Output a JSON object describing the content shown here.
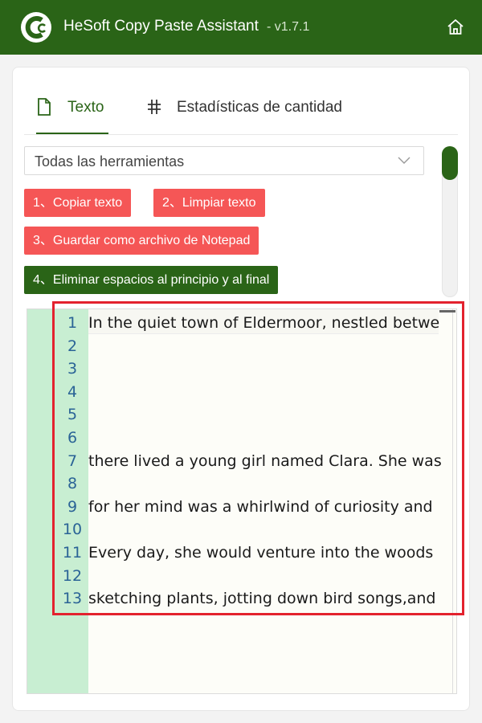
{
  "window": {
    "title": "HeSoft Copy Paste Assistant",
    "version": "- v1.7.1",
    "brand_color": "#2a6417",
    "danger_color": "#f55656",
    "icons": {
      "logo": "logo-icon",
      "home": "home-icon"
    }
  },
  "tabs": [
    {
      "label": "Texto",
      "icon": "document-icon",
      "active": true
    },
    {
      "label": "Estadísticas de cantidad",
      "icon": "hash-icon",
      "active": false
    }
  ],
  "tool_select": {
    "value": "Todas las herramientas"
  },
  "buttons": [
    {
      "label": "1、Copiar texto",
      "style": "red"
    },
    {
      "label": "2、Limpiar texto",
      "style": "red"
    },
    {
      "label": "3、Guardar como archivo de Notepad",
      "style": "red"
    },
    {
      "label": "4、Eliminar espacios al principio y al final",
      "style": "green"
    }
  ],
  "editor": {
    "lines": [
      {
        "num": "1",
        "text": "In the quiet town of Eldermoor, nestled betwe"
      },
      {
        "num": "2",
        "text": ""
      },
      {
        "num": "3",
        "text": ""
      },
      {
        "num": "4",
        "text": ""
      },
      {
        "num": "5",
        "text": ""
      },
      {
        "num": "6",
        "text": ""
      },
      {
        "num": "7",
        "text": "there lived a young girl named Clara. She was"
      },
      {
        "num": "8",
        "text": ""
      },
      {
        "num": "9",
        "text": "for her mind was a whirlwind of curiosity and"
      },
      {
        "num": "10",
        "text": ""
      },
      {
        "num": "11",
        "text": "Every day, she would venture into the woods"
      },
      {
        "num": "12",
        "text": ""
      },
      {
        "num": "13",
        "text": "sketching plants, jotting down bird songs,and"
      }
    ],
    "annotation_color": "#e3222e"
  }
}
